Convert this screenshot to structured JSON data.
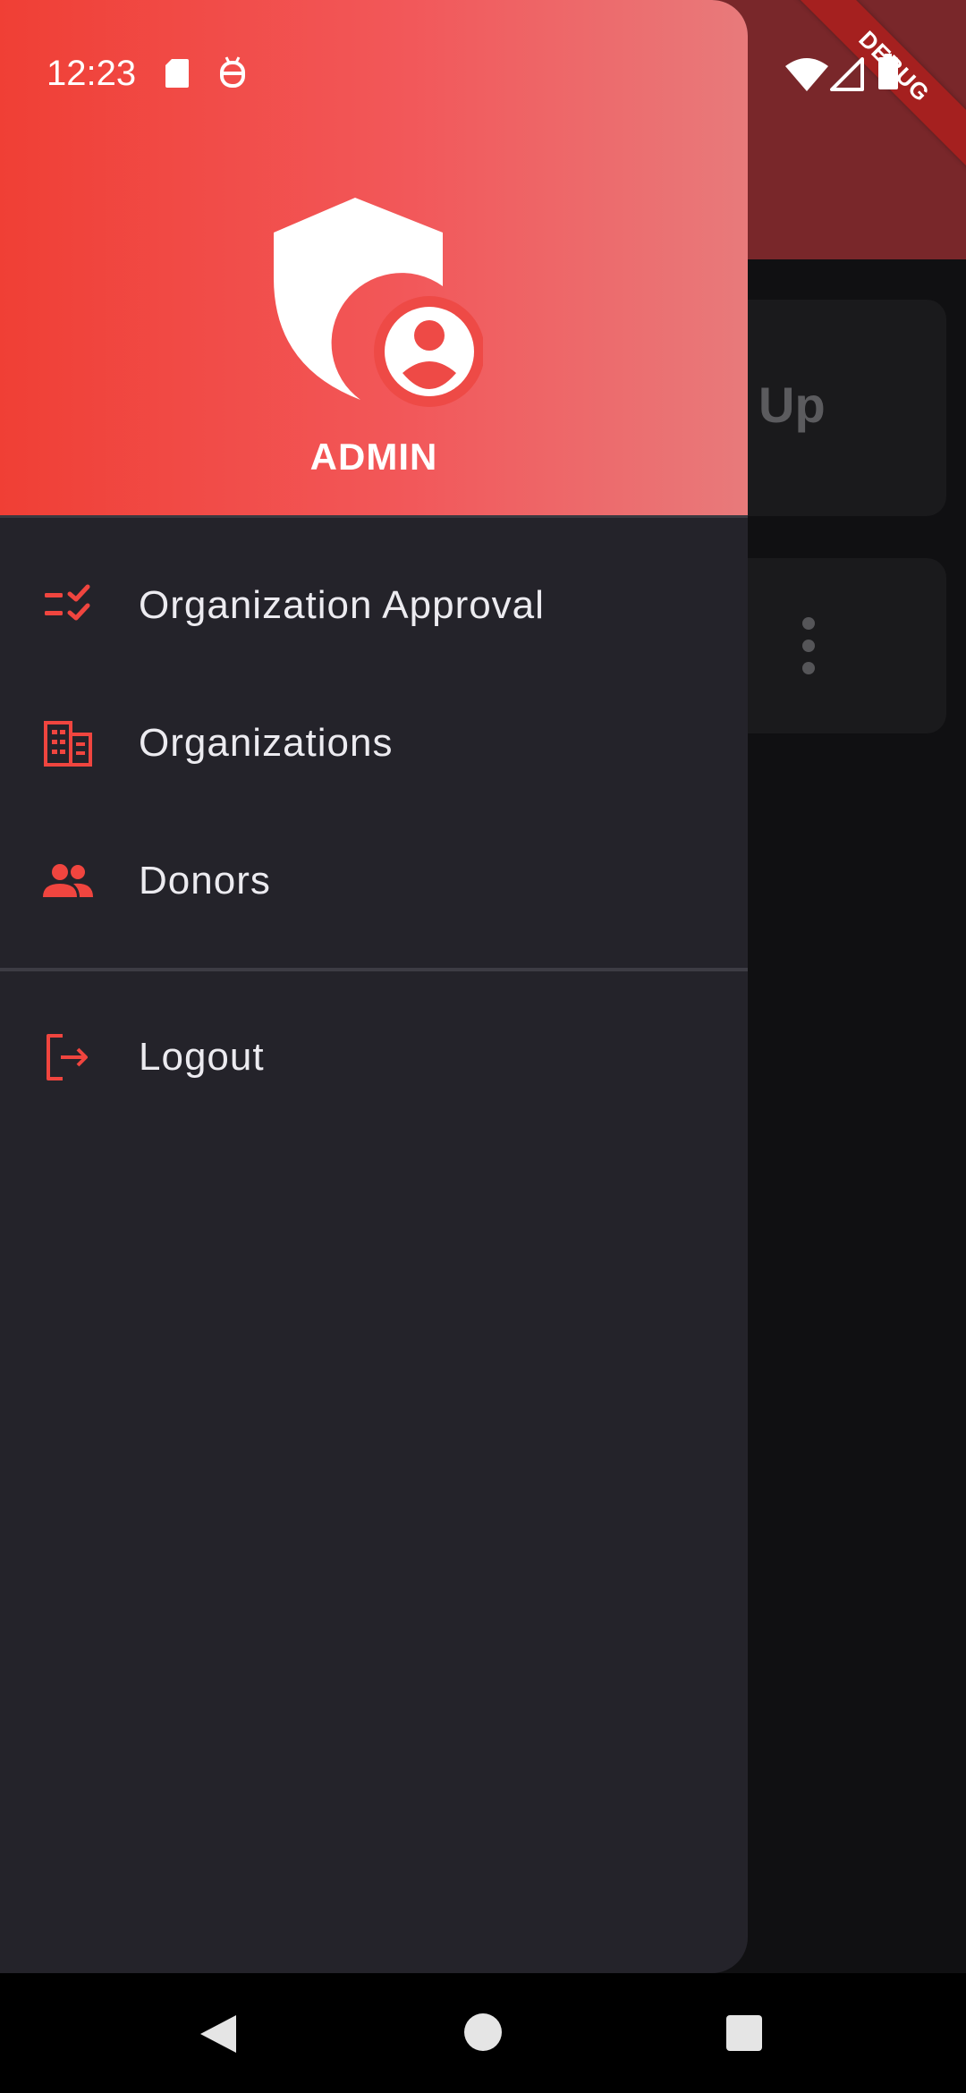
{
  "status_bar": {
    "time": "12:23"
  },
  "debug_banner": "DEBUG",
  "background": {
    "card_text": "Up"
  },
  "drawer": {
    "header": {
      "title": "ADMIN"
    },
    "menu": [
      {
        "label": "Organization Approval",
        "icon": "checklist-icon"
      },
      {
        "label": "Organizations",
        "icon": "organization-building-icon"
      },
      {
        "label": "Donors",
        "icon": "people-icon"
      }
    ],
    "logout": {
      "label": "Logout",
      "icon": "logout-icon"
    }
  },
  "colors": {
    "accent": "#f0453f",
    "drawer_bg": "#24232a",
    "header_gradient_start": "#f03f35",
    "header_gradient_end": "#e87a7b"
  }
}
